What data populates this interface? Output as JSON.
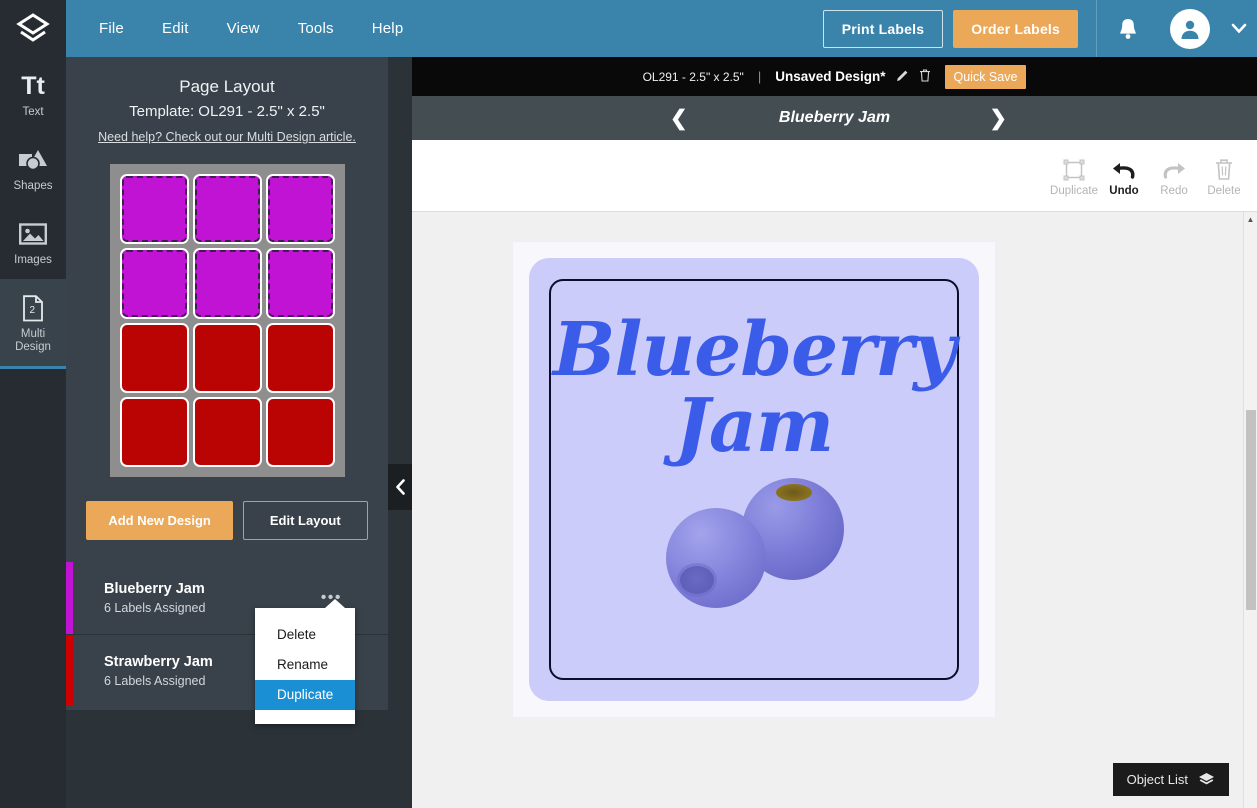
{
  "header": {
    "logo_icon": "layers-logo-icon",
    "menu": [
      {
        "label": "File"
      },
      {
        "label": "Edit"
      },
      {
        "label": "View"
      },
      {
        "label": "Tools"
      },
      {
        "label": "Help"
      }
    ],
    "print_labels": "Print Labels",
    "order_labels": "Order Labels",
    "bell_icon": "notification-bell-icon",
    "avatar_icon": "user-avatar-icon",
    "caret_icon": "chevron-down-icon",
    "bg_color": "#3a83ab",
    "order_button_color": "#eba859"
  },
  "rail": {
    "items": [
      {
        "label": "Text",
        "icon": "text-icon",
        "active": false
      },
      {
        "label": "Shapes",
        "icon": "shapes-icon",
        "active": false
      },
      {
        "label": "Images",
        "icon": "images-icon",
        "active": false
      },
      {
        "label_line1": "Multi",
        "label_line2": "Design",
        "icon": "multi-design-icon",
        "active": true
      }
    ]
  },
  "panel": {
    "title": "Page Layout",
    "subtitle": "Template: OL291 - 2.5\" x 2.5\"",
    "help_link": "Need help? Check out our Multi Design article.",
    "sheet": {
      "columns": 3,
      "rows": 4,
      "selected_color": "#c113d4",
      "other_color": "#ba0404",
      "cells": [
        {
          "color": "#c113d4",
          "selected": true
        },
        {
          "color": "#c113d4",
          "selected": true
        },
        {
          "color": "#c113d4",
          "selected": true
        },
        {
          "color": "#c113d4",
          "selected": true
        },
        {
          "color": "#c113d4",
          "selected": true
        },
        {
          "color": "#c113d4",
          "selected": true
        },
        {
          "color": "#ba0404",
          "selected": false
        },
        {
          "color": "#ba0404",
          "selected": false
        },
        {
          "color": "#ba0404",
          "selected": false
        },
        {
          "color": "#ba0404",
          "selected": false
        },
        {
          "color": "#ba0404",
          "selected": false
        },
        {
          "color": "#ba0404",
          "selected": false
        }
      ]
    },
    "add_new_design": "Add New Design",
    "edit_layout": "Edit Layout",
    "designs": [
      {
        "name": "Blueberry Jam",
        "count": "6 Labels Assigned",
        "color": "#c113d4",
        "menu_icon": "more-options-icon"
      },
      {
        "name": "Strawberry Jam",
        "count": "6 Labels Assigned",
        "color": "#cc0000",
        "menu_icon": "more-options-icon"
      }
    ],
    "context_menu": {
      "items": [
        {
          "label": "Delete",
          "selected": false
        },
        {
          "label": "Rename",
          "selected": false
        },
        {
          "label": "Duplicate",
          "selected": true
        }
      ],
      "highlight_color": "#1a8fd4"
    },
    "collapse_icon": "chevron-left-icon"
  },
  "stage": {
    "doc_bar": {
      "template": "OL291 - 2.5\" x 2.5\"",
      "separator": "|",
      "title": "Unsaved Design*",
      "edit_icon": "pencil-icon",
      "delete_icon": "trash-icon",
      "quick_save": "Quick Save"
    },
    "nav_bar": {
      "prev_icon": "chevron-left-icon",
      "next_icon": "chevron-right-icon",
      "title": "Blueberry Jam"
    },
    "toolbar": [
      {
        "label": "Duplicate",
        "icon": "duplicate-icon",
        "enabled": false
      },
      {
        "label": "Undo",
        "icon": "undo-icon",
        "enabled": true
      },
      {
        "label": "Redo",
        "icon": "redo-icon",
        "enabled": false
      },
      {
        "label": "Delete",
        "icon": "trash-icon",
        "enabled": false
      }
    ],
    "label": {
      "line1": "Blueberry",
      "line2": "Jam",
      "text_color": "#3b5ce8",
      "background_color": "#ccccfa",
      "border_color": "#0d0d2b",
      "artwork": "blueberries-image"
    },
    "object_list": {
      "label": "Object List",
      "icon": "layers-icon"
    },
    "scrollbar_icon": "scroll-up-arrow-icon"
  }
}
